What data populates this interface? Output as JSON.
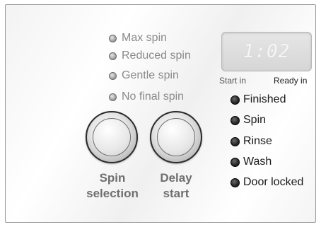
{
  "spin_options": [
    {
      "label": "Max spin"
    },
    {
      "label": "Reduced spin"
    },
    {
      "label": "Gentle spin"
    },
    {
      "label": "No final spin"
    }
  ],
  "display": {
    "value": "1:02",
    "caption_left": "Start in",
    "caption_right": "Ready in"
  },
  "status_lights": [
    {
      "label": "Finished"
    },
    {
      "label": "Spin"
    },
    {
      "label": "Rinse"
    },
    {
      "label": "Wash"
    },
    {
      "label": "Door locked"
    }
  ],
  "buttons": {
    "spin_selection": {
      "line1": "Spin",
      "line2": "selection"
    },
    "delay_start": {
      "line1": "Delay",
      "line2": "start"
    }
  }
}
